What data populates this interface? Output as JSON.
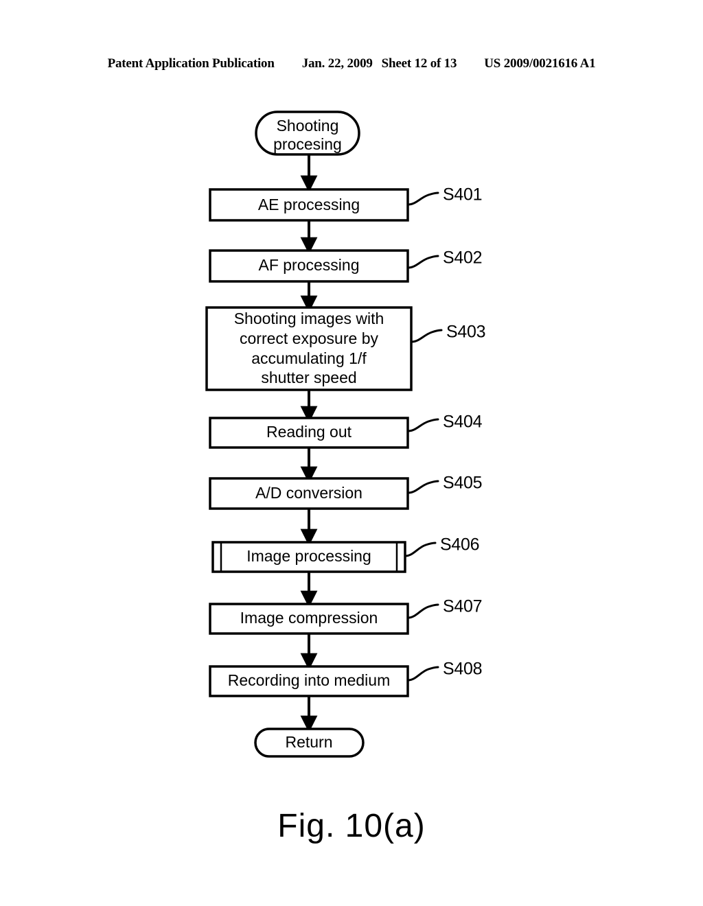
{
  "header": {
    "publication": "Patent Application Publication",
    "date": "Jan. 22, 2009",
    "sheet": "Sheet 12 of 13",
    "patent_number": "US 2009/0021616 A1"
  },
  "figure": {
    "caption": "Fig. 10(a)",
    "type": "flowchart",
    "start_node": {
      "label_line1": "Shooting",
      "label_line2": "procesing",
      "shape": "rounded-terminal"
    },
    "end_node": {
      "label": "Return",
      "shape": "rounded-terminal"
    },
    "steps": [
      {
        "id": "S401",
        "label": "AE processing",
        "shape": "process",
        "lines": [
          "AE processing"
        ]
      },
      {
        "id": "S402",
        "label": "AF processing",
        "shape": "process",
        "lines": [
          "AF processing"
        ]
      },
      {
        "id": "S403",
        "label": "Shooting images with correct exposure by accumulating 1/f shutter speed",
        "shape": "process",
        "lines": [
          "Shooting images with",
          "correct exposure by",
          "accumulating 1/f",
          "shutter speed"
        ]
      },
      {
        "id": "S404",
        "label": "Reading out",
        "shape": "process",
        "lines": [
          "Reading out"
        ]
      },
      {
        "id": "S405",
        "label": "A/D conversion",
        "shape": "process",
        "lines": [
          "A/D conversion"
        ]
      },
      {
        "id": "S406",
        "label": "Image processing",
        "shape": "predefined-process",
        "lines": [
          "Image processing"
        ]
      },
      {
        "id": "S407",
        "label": "Image compression",
        "shape": "process",
        "lines": [
          "Image compression"
        ]
      },
      {
        "id": "S408",
        "label": "Recording into medium",
        "shape": "process",
        "lines": [
          "Recording into medium"
        ]
      }
    ]
  },
  "colors": {
    "ink": "#000000",
    "paper": "#ffffff"
  }
}
